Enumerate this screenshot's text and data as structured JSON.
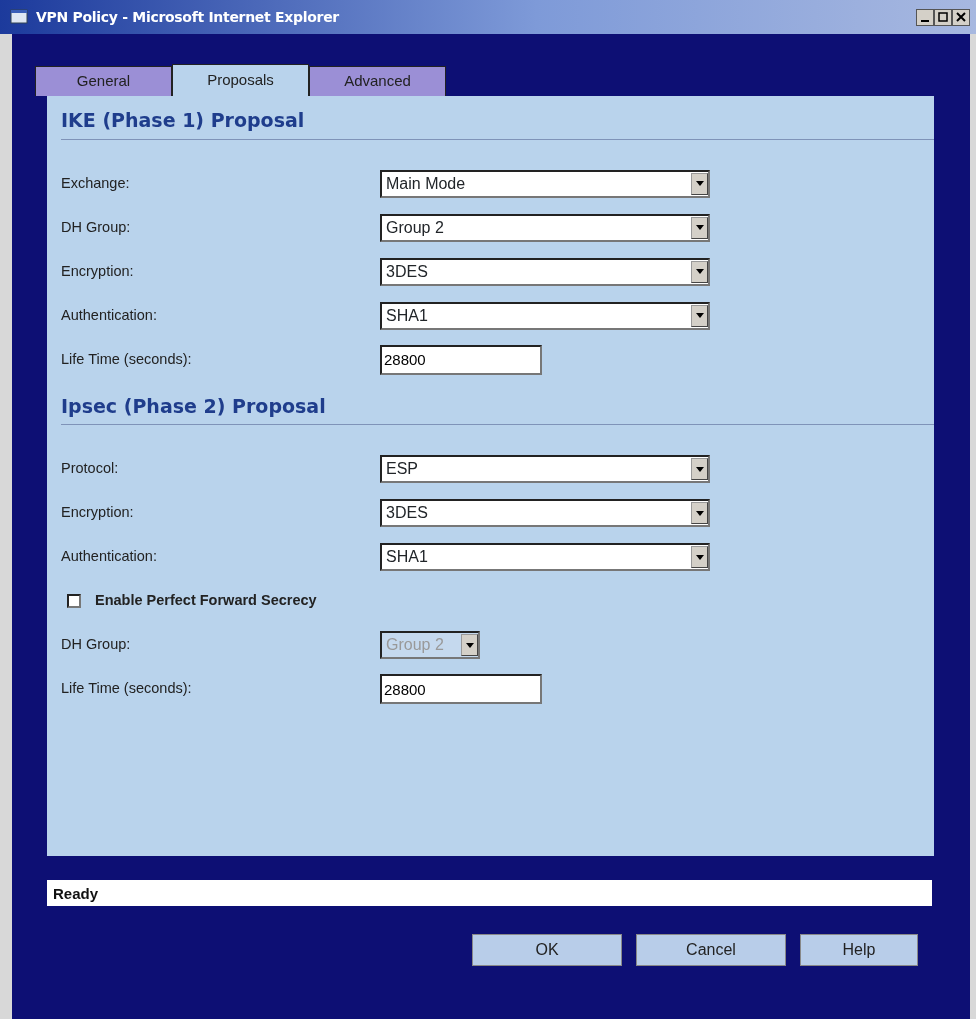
{
  "window": {
    "title": "VPN Policy - Microsoft Internet Explorer"
  },
  "tabs": [
    {
      "label": "General",
      "selected": false
    },
    {
      "label": "Proposals",
      "selected": true
    },
    {
      "label": "Advanced",
      "selected": false
    }
  ],
  "sections": [
    {
      "title": "IKE (Phase 1) Proposal",
      "fields": [
        {
          "kind": "select",
          "label": "Exchange:",
          "value": "Main Mode",
          "disabled": false
        },
        {
          "kind": "select",
          "label": "DH Group:",
          "value": "Group 2",
          "disabled": false
        },
        {
          "kind": "select",
          "label": "Encryption:",
          "value": "3DES",
          "disabled": false
        },
        {
          "kind": "select",
          "label": "Authentication:",
          "value": "SHA1",
          "disabled": false
        },
        {
          "kind": "text",
          "label": "Life Time (seconds):",
          "value": "28800"
        }
      ]
    },
    {
      "title": "Ipsec (Phase 2) Proposal",
      "fields": [
        {
          "kind": "select",
          "label": "Protocol:",
          "value": "ESP",
          "disabled": false
        },
        {
          "kind": "select",
          "label": "Encryption:",
          "value": "3DES",
          "disabled": false
        },
        {
          "kind": "select",
          "label": "Authentication:",
          "value": "SHA1",
          "disabled": false
        },
        {
          "kind": "checkbox",
          "label": "Enable Perfect Forward Secrecy",
          "checked": false
        },
        {
          "kind": "select",
          "label": "DH Group:",
          "value": "Group 2",
          "disabled": true
        },
        {
          "kind": "text",
          "label": "Life Time (seconds):",
          "value": "28800"
        }
      ]
    }
  ],
  "status_bar": "Ready",
  "buttons": [
    "OK",
    "Cancel",
    "Help"
  ]
}
